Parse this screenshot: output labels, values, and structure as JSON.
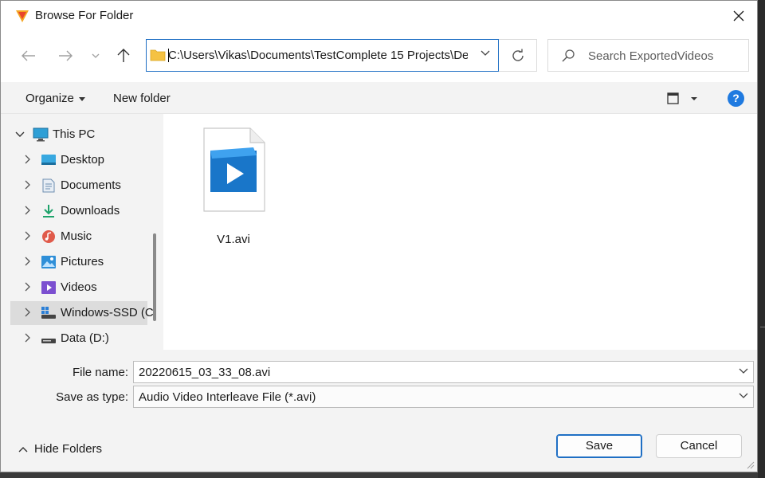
{
  "window": {
    "title": "Browse For Folder"
  },
  "nav": {
    "address": "C:\\Users\\Vikas\\Documents\\TestComplete 15 Projects\\De",
    "search_placeholder": "Search ExportedVideos"
  },
  "commands": {
    "organize": "Organize",
    "new_folder": "New folder"
  },
  "help_label": "?",
  "tree": [
    {
      "label": "This PC",
      "icon": "monitor-icon",
      "expanded": true
    },
    {
      "label": "Desktop",
      "icon": "desktop-icon"
    },
    {
      "label": "Documents",
      "icon": "documents-icon"
    },
    {
      "label": "Downloads",
      "icon": "download-icon"
    },
    {
      "label": "Music",
      "icon": "music-icon"
    },
    {
      "label": "Pictures",
      "icon": "pictures-icon"
    },
    {
      "label": "Videos",
      "icon": "videos-icon"
    },
    {
      "label": "Windows-SSD (C",
      "icon": "drive-icon",
      "selected": true
    },
    {
      "label": "Data (D:)",
      "icon": "drive-icon"
    }
  ],
  "files": [
    {
      "name": "V1.avi",
      "icon": "video-file-icon"
    }
  ],
  "form": {
    "file_name_label": "File name:",
    "file_name_value": "20220615_03_33_08.avi",
    "save_type_label": "Save as type:",
    "save_type_value": "Audio Video Interleave File (*.avi)"
  },
  "hide_folders": "Hide Folders",
  "buttons": {
    "save": "Save",
    "cancel": "Cancel"
  },
  "colors": {
    "accent": "#1f6fc4",
    "help": "#1f7ae0",
    "folder": "#f5c242"
  }
}
